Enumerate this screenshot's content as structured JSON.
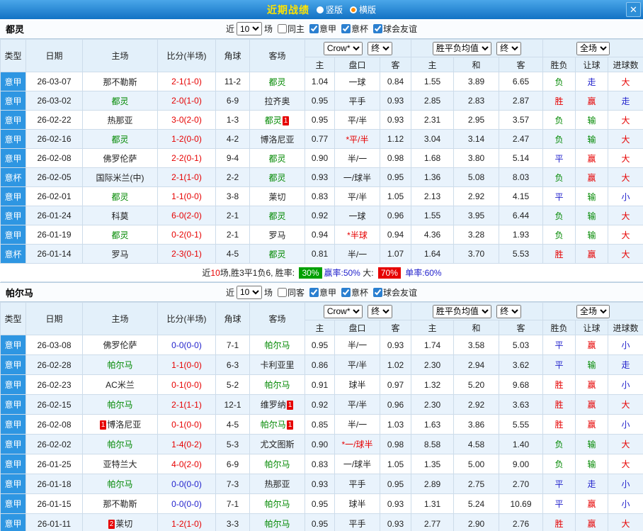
{
  "titlebar": {
    "title": "近期战绩",
    "radio_vertical": "竖版",
    "radio_horizontal": "横版",
    "close": "✕"
  },
  "filters": {
    "near_label": "近",
    "near_value": "10",
    "games_label": "场",
    "league": "意甲",
    "cup": "意杯",
    "friendly": "球会友谊"
  },
  "header": {
    "type": "类型",
    "date": "日期",
    "home": "主场",
    "score": "比分(半场)",
    "corners": "角球",
    "away": "客场",
    "odds_source": "Crow*",
    "final": "终",
    "avg": "胜平负均值",
    "full": "全场",
    "h": "主",
    "handicap": "盘口",
    "a": "客",
    "draw": "和",
    "result": "胜负",
    "let_goal": "让球",
    "goals": "进球数"
  },
  "colors": {
    "title_yellow": "#ffe400",
    "bar_blue": "#1272c4",
    "league_badge": "#2e96e2",
    "cup_badge": "#1f51a8",
    "win_red": "#e60000",
    "lose_green": "#008800",
    "draw_blue": "#2222cc"
  },
  "sections": [
    {
      "team": "都灵",
      "same_label": "同主",
      "rows": [
        {
          "league": "意甲",
          "date": "26-03-07",
          "home": "那不勒斯",
          "score": "2-1(1-0)",
          "corners": "11-2",
          "away": "都灵",
          "away_focal": true,
          "odds_home": "1.04",
          "handicap": "一球",
          "odds_away": "0.84",
          "avg_home": "1.55",
          "avg_draw": "3.89",
          "avg_away": "6.65",
          "result": "负",
          "let_result": "走",
          "goal_result": "大"
        },
        {
          "league": "意甲",
          "date": "26-03-02",
          "home": "都灵",
          "home_focal": true,
          "score": "2-0(1-0)",
          "corners": "6-9",
          "away": "拉齐奥",
          "odds_home": "0.95",
          "handicap": "平手",
          "odds_away": "0.93",
          "avg_home": "2.85",
          "avg_draw": "2.83",
          "avg_away": "2.87",
          "result": "胜",
          "let_result": "赢",
          "goal_result": "走"
        },
        {
          "league": "意甲",
          "date": "26-02-22",
          "home": "热那亚",
          "score": "3-0(2-0)",
          "corners": "1-3",
          "away": "都灵",
          "away_focal": true,
          "away_badge_after": "1",
          "odds_home": "0.95",
          "handicap": "平/半",
          "odds_away": "0.93",
          "avg_home": "2.31",
          "avg_draw": "2.95",
          "avg_away": "3.57",
          "result": "负",
          "let_result": "输",
          "goal_result": "大"
        },
        {
          "league": "意甲",
          "date": "26-02-16",
          "home": "都灵",
          "home_focal": true,
          "score": "1-2(0-0)",
          "corners": "4-2",
          "away": "博洛尼亚",
          "odds_home": "0.77",
          "handicap": "*平/半",
          "handicap_star": true,
          "odds_away": "1.12",
          "avg_home": "3.04",
          "avg_draw": "3.14",
          "avg_away": "2.47",
          "result": "负",
          "let_result": "输",
          "goal_result": "大"
        },
        {
          "league": "意甲",
          "date": "26-02-08",
          "home": "佛罗伦萨",
          "score": "2-2(0-1)",
          "corners": "9-4",
          "away": "都灵",
          "away_focal": true,
          "odds_home": "0.90",
          "handicap": "半/一",
          "odds_away": "0.98",
          "avg_home": "1.68",
          "avg_draw": "3.80",
          "avg_away": "5.14",
          "result": "平",
          "let_result": "赢",
          "goal_result": "大"
        },
        {
          "league": "意杯",
          "is_cup": true,
          "date": "26-02-05",
          "home": "国际米兰(中)",
          "score": "2-1(1-0)",
          "corners": "2-2",
          "away": "都灵",
          "away_focal": true,
          "odds_home": "0.93",
          "handicap": "一/球半",
          "odds_away": "0.95",
          "avg_home": "1.36",
          "avg_draw": "5.08",
          "avg_away": "8.03",
          "result": "负",
          "let_result": "赢",
          "goal_result": "大"
        },
        {
          "league": "意甲",
          "date": "26-02-01",
          "home": "都灵",
          "home_focal": true,
          "score": "1-1(0-0)",
          "corners": "3-8",
          "away": "莱切",
          "odds_home": "0.83",
          "handicap": "平/半",
          "odds_away": "1.05",
          "avg_home": "2.13",
          "avg_draw": "2.92",
          "avg_away": "4.15",
          "result": "平",
          "let_result": "输",
          "goal_result": "小"
        },
        {
          "league": "意甲",
          "date": "26-01-24",
          "home": "科莫",
          "score": "6-0(2-0)",
          "corners": "2-1",
          "away": "都灵",
          "away_focal": true,
          "odds_home": "0.92",
          "handicap": "一球",
          "odds_away": "0.96",
          "avg_home": "1.55",
          "avg_draw": "3.95",
          "avg_away": "6.44",
          "result": "负",
          "let_result": "输",
          "goal_result": "大"
        },
        {
          "league": "意甲",
          "date": "26-01-19",
          "home": "都灵",
          "home_focal": true,
          "score": "0-2(0-1)",
          "corners": "2-1",
          "away": "罗马",
          "odds_home": "0.94",
          "handicap": "*半球",
          "handicap_star": true,
          "odds_away": "0.94",
          "avg_home": "4.36",
          "avg_draw": "3.28",
          "avg_away": "1.93",
          "result": "负",
          "let_result": "输",
          "goal_result": "大"
        },
        {
          "league": "意杯",
          "is_cup": true,
          "date": "26-01-14",
          "home": "罗马",
          "score": "2-3(0-1)",
          "corners": "4-5",
          "away": "都灵",
          "away_focal": true,
          "odds_home": "0.81",
          "handicap": "半/一",
          "odds_away": "1.07",
          "avg_home": "1.64",
          "avg_draw": "3.70",
          "avg_away": "5.53",
          "result": "胜",
          "let_result": "赢",
          "goal_result": "大"
        }
      ],
      "summary": {
        "text_before": "近",
        "count": "10",
        "text_mid": "场,胜3平1负6, 胜率: ",
        "win_pct": "30%",
        "handicap_text": "赢率:50%",
        "big_label": " 大: ",
        "big_pct": "70%",
        "single_text": "单率:60%"
      }
    },
    {
      "team": "帕尔马",
      "same_label": "同客",
      "rows": [
        {
          "league": "意甲",
          "date": "26-03-08",
          "home": "佛罗伦萨",
          "score": "0-0(0-0)",
          "score_blue": true,
          "corners": "7-1",
          "away": "帕尔马",
          "away_focal": true,
          "odds_home": "0.95",
          "handicap": "半/一",
          "odds_away": "0.93",
          "avg_home": "1.74",
          "avg_draw": "3.58",
          "avg_away": "5.03",
          "result": "平",
          "let_result": "赢",
          "goal_result": "小"
        },
        {
          "league": "意甲",
          "date": "26-02-28",
          "home": "帕尔马",
          "home_focal": true,
          "score": "1-1(0-0)",
          "corners": "6-3",
          "away": "卡利亚里",
          "odds_home": "0.86",
          "handicap": "平/半",
          "odds_away": "1.02",
          "avg_home": "2.30",
          "avg_draw": "2.94",
          "avg_away": "3.62",
          "result": "平",
          "let_result": "输",
          "goal_result": "走"
        },
        {
          "league": "意甲",
          "date": "26-02-23",
          "home": "AC米兰",
          "score": "0-1(0-0)",
          "corners": "5-2",
          "away": "帕尔马",
          "away_focal": true,
          "odds_home": "0.91",
          "handicap": "球半",
          "odds_away": "0.97",
          "avg_home": "1.32",
          "avg_draw": "5.20",
          "avg_away": "9.68",
          "result": "胜",
          "let_result": "赢",
          "goal_result": "小"
        },
        {
          "league": "意甲",
          "date": "26-02-15",
          "home": "帕尔马",
          "home_focal": true,
          "score": "2-1(1-1)",
          "corners": "12-1",
          "away": "维罗纳",
          "away_badge_after": "1",
          "odds_home": "0.92",
          "handicap": "平/半",
          "odds_away": "0.96",
          "avg_home": "2.30",
          "avg_draw": "2.92",
          "avg_away": "3.63",
          "result": "胜",
          "let_result": "赢",
          "goal_result": "大"
        },
        {
          "league": "意甲",
          "date": "26-02-08",
          "home": "博洛尼亚",
          "home_badge_before": "1",
          "score": "0-1(0-0)",
          "corners": "4-5",
          "away": "帕尔马",
          "away_focal": true,
          "away_badge_after": "1",
          "odds_home": "0.85",
          "handicap": "半/一",
          "odds_away": "1.03",
          "avg_home": "1.63",
          "avg_draw": "3.86",
          "avg_away": "5.55",
          "result": "胜",
          "let_result": "赢",
          "goal_result": "小"
        },
        {
          "league": "意甲",
          "date": "26-02-02",
          "home": "帕尔马",
          "home_focal": true,
          "score": "1-4(0-2)",
          "corners": "5-3",
          "away": "尤文图斯",
          "odds_home": "0.90",
          "handicap": "*一/球半",
          "handicap_star": true,
          "odds_away": "0.98",
          "avg_home": "8.58",
          "avg_draw": "4.58",
          "avg_away": "1.40",
          "result": "负",
          "let_result": "输",
          "goal_result": "大"
        },
        {
          "league": "意甲",
          "date": "26-01-25",
          "home": "亚特兰大",
          "score": "4-0(2-0)",
          "corners": "6-9",
          "away": "帕尔马",
          "away_focal": true,
          "odds_home": "0.83",
          "handicap": "一/球半",
          "odds_away": "1.05",
          "avg_home": "1.35",
          "avg_draw": "5.00",
          "avg_away": "9.00",
          "result": "负",
          "let_result": "输",
          "goal_result": "大"
        },
        {
          "league": "意甲",
          "date": "26-01-18",
          "home": "帕尔马",
          "home_focal": true,
          "score": "0-0(0-0)",
          "score_blue": true,
          "corners": "7-3",
          "away": "热那亚",
          "odds_home": "0.93",
          "handicap": "平手",
          "odds_away": "0.95",
          "avg_home": "2.89",
          "avg_draw": "2.75",
          "avg_away": "2.70",
          "result": "平",
          "let_result": "走",
          "goal_result": "小"
        },
        {
          "league": "意甲",
          "date": "26-01-15",
          "home": "那不勒斯",
          "score": "0-0(0-0)",
          "score_blue": true,
          "corners": "7-1",
          "away": "帕尔马",
          "away_focal": true,
          "odds_home": "0.95",
          "handicap": "球半",
          "odds_away": "0.93",
          "avg_home": "1.31",
          "avg_draw": "5.24",
          "avg_away": "10.69",
          "result": "平",
          "let_result": "赢",
          "goal_result": "小"
        },
        {
          "league": "意甲",
          "date": "26-01-11",
          "home": "莱切",
          "home_badge_before": "2",
          "score": "1-2(1-0)",
          "corners": "3-3",
          "away": "帕尔马",
          "away_focal": true,
          "odds_home": "0.95",
          "handicap": "平手",
          "odds_away": "0.93",
          "avg_home": "2.77",
          "avg_draw": "2.90",
          "avg_away": "2.76",
          "result": "胜",
          "let_result": "赢",
          "goal_result": "大"
        }
      ]
    }
  ]
}
